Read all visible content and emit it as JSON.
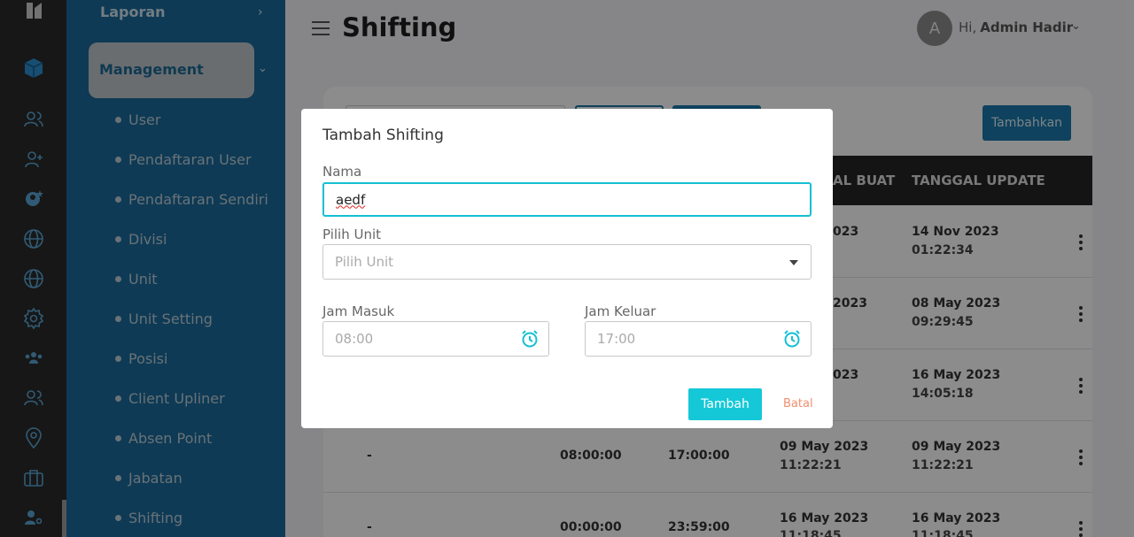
{
  "header": {
    "title": "Shifting",
    "avatar_initial": "A",
    "greeting": "Hi,",
    "user_name": "Admin Hadir"
  },
  "sidebar": {
    "laporan": "Laporan",
    "management": "Management",
    "items": [
      {
        "label": "User"
      },
      {
        "label": "Pendaftaran User"
      },
      {
        "label": "Pendaftaran Sendiri"
      },
      {
        "label": "Divisi"
      },
      {
        "label": "Unit"
      },
      {
        "label": "Unit Setting"
      },
      {
        "label": "Posisi"
      },
      {
        "label": "Client Upliner"
      },
      {
        "label": "Absen Point"
      },
      {
        "label": "Jabatan"
      },
      {
        "label": "Shifting"
      }
    ]
  },
  "rail_icons": [
    "logo-icon",
    "box-icon",
    "users-icon",
    "user-add-icon",
    "user-star-icon",
    "globe-icon",
    "globe-icon",
    "settings-icon",
    "group-icon",
    "users-icon",
    "location-icon",
    "briefcase-icon",
    "user-gear-icon"
  ],
  "toolbar": {
    "add_label": "Tambahkan"
  },
  "table": {
    "headers": {
      "created": "AL BUAT",
      "updated": "TANGGAL UPDATE"
    },
    "rows": [
      {
        "created_date": "023",
        "updated_date": "14 Nov 2023",
        "updated_time": "01:22:34"
      },
      {
        "created_date": "2023",
        "updated_date": "08 May 2023",
        "updated_time": "09:29:45"
      },
      {
        "created_date": "023",
        "updated_date": "16 May 2023",
        "updated_time": "14:05:18"
      },
      {
        "name": "-",
        "jam_masuk": "08:00:00",
        "jam_keluar": "17:00:00",
        "created_date": "09 May 2023",
        "created_time": "11:22:21",
        "updated_date": "09 May 2023",
        "updated_time": "11:22:21"
      },
      {
        "name": "-",
        "jam_masuk": "00:00:00",
        "jam_keluar": "23:59:00",
        "created_date": "16 May 2023",
        "created_time": "11:18:45",
        "updated_date": "16 May 2023",
        "updated_time": "11:18:45"
      }
    ]
  },
  "modal": {
    "title": "Tambah Shifting",
    "nama_label": "Nama",
    "nama_value": "aedf",
    "unit_label": "Pilih Unit",
    "unit_placeholder": "Pilih Unit",
    "jam_masuk_label": "Jam Masuk",
    "jam_masuk_placeholder": "08:00",
    "jam_keluar_label": "Jam Keluar",
    "jam_keluar_placeholder": "17:00",
    "submit_label": "Tambah",
    "cancel_label": "Batal"
  },
  "colors": {
    "sidebar": "#1a6b9c",
    "accent": "#14c8d8",
    "cancel": "#f08f6e"
  }
}
